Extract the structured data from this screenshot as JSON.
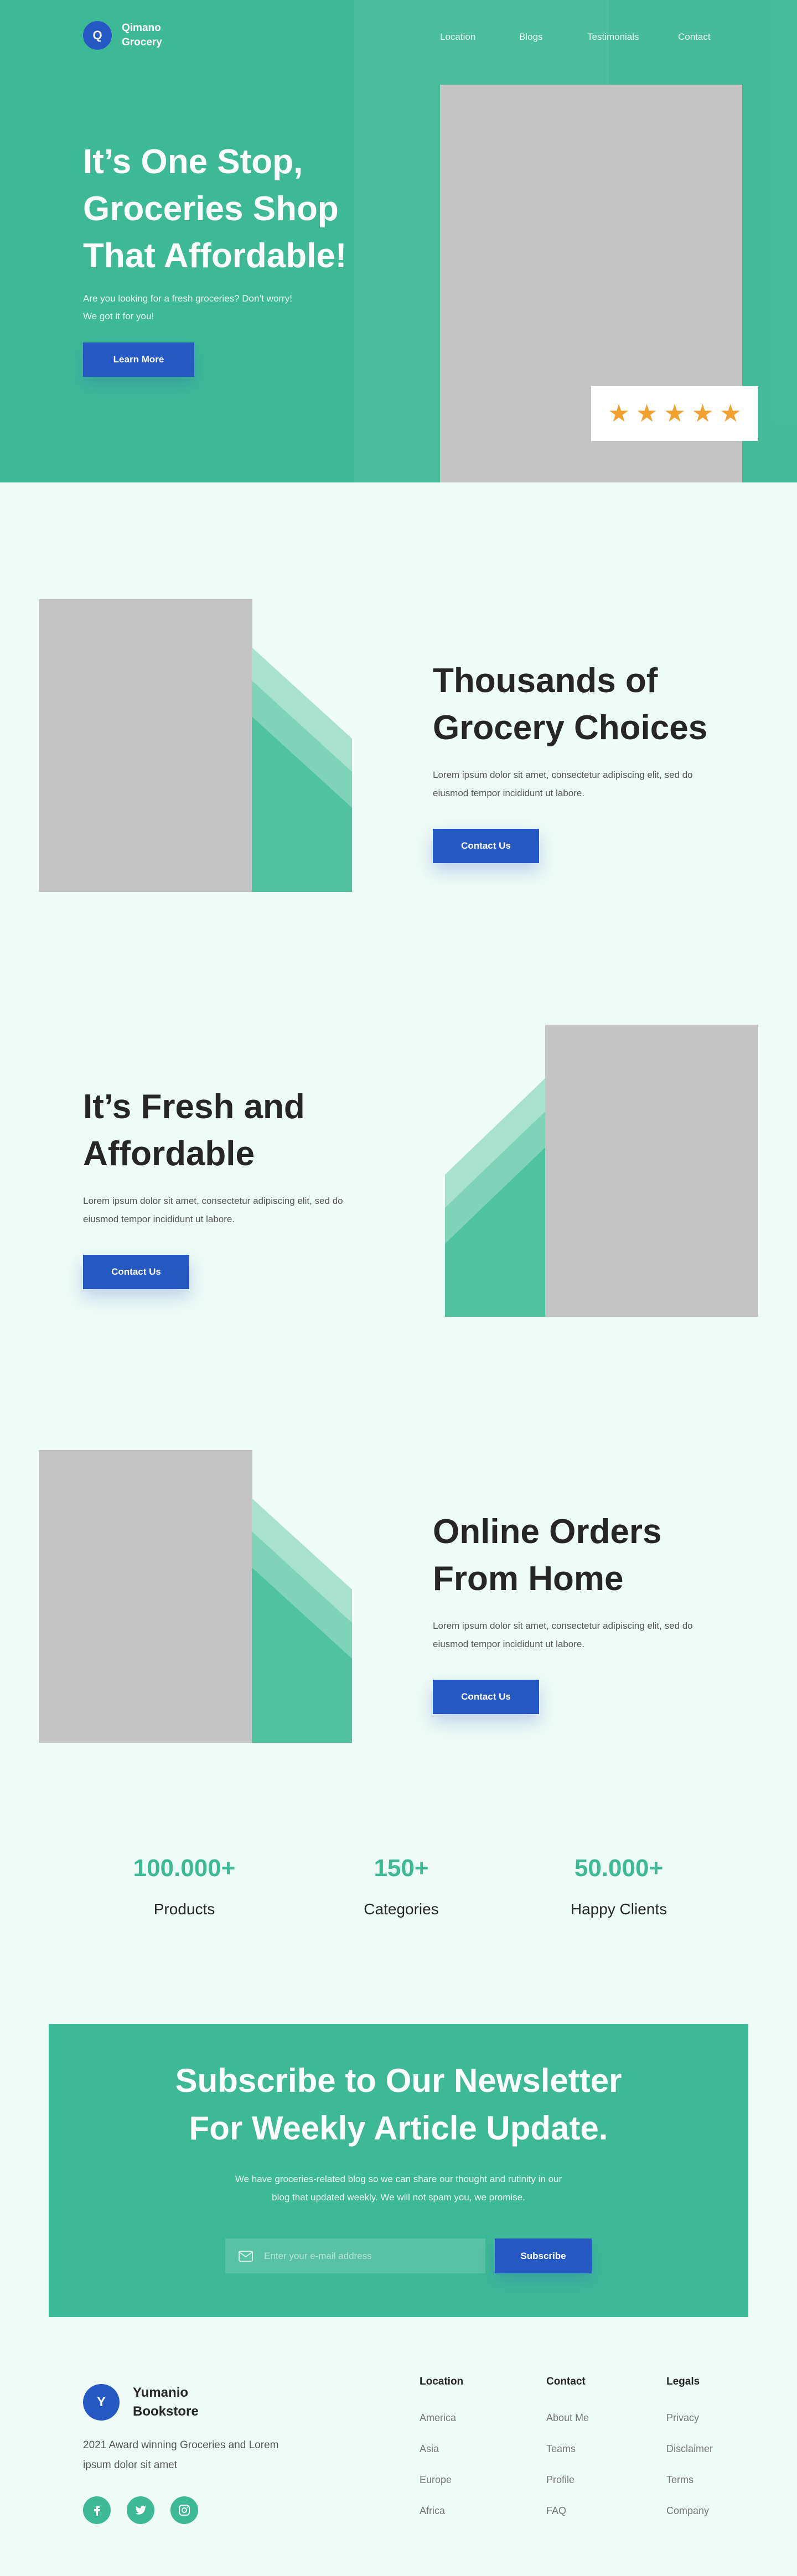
{
  "brand": {
    "initial": "Q",
    "name": "Qimano Grocery"
  },
  "nav": [
    "Location",
    "Blogs",
    "Testimonials",
    "Contact"
  ],
  "hero": {
    "title": "It’s One Stop, Groceries Shop That Affordable!",
    "subtitle_line1": "Are you looking for a fresh groceries? Don’t worry!",
    "subtitle_line2": "We got it for you!",
    "cta": "Learn More",
    "rating": {
      "stars": 5,
      "max": 5
    }
  },
  "features": [
    {
      "title": "Thousands of Grocery Choices",
      "text": "Lorem ipsum dolor sit amet, consectetur adipiscing elit, sed do eiusmod tempor incididunt ut labore.",
      "cta": "Contact Us"
    },
    {
      "title": "It’s Fresh and Affordable",
      "text": "Lorem ipsum dolor sit amet, consectetur adipiscing elit, sed do eiusmod tempor incididunt ut labore.",
      "cta": "Contact Us"
    },
    {
      "title": "Online Orders From Home",
      "text": "Lorem ipsum dolor sit amet, consectetur adipiscing elit, sed do eiusmod tempor incididunt ut labore.",
      "cta": "Contact Us"
    }
  ],
  "stats": [
    {
      "value": "100.000+",
      "label": "Products"
    },
    {
      "value": "150+",
      "label": "Categories"
    },
    {
      "value": "50.000+",
      "label": "Happy Clients"
    }
  ],
  "newsletter": {
    "title_line1": "Subscribe to Our Newsletter",
    "title_line2": "For Weekly Article Update.",
    "text_line1": "We have groceries-related blog so we can share our thought and rutinity in our",
    "text_line2": "blog that updated weekly. We will not spam you, we promise.",
    "placeholder": "Enter your e-mail address",
    "button": "Subscribe"
  },
  "footer": {
    "initial": "Y",
    "name": "Yumanio Bookstore",
    "description": "2021 Award winning Groceries and Lorem ipsum dolor sit amet",
    "social": [
      "facebook-icon",
      "twitter-icon",
      "instagram-icon"
    ],
    "columns": [
      {
        "heading": "Location",
        "links": [
          "America",
          "Asia",
          "Europe",
          "Africa"
        ]
      },
      {
        "heading": "Contact",
        "links": [
          "About Me",
          "Teams",
          "Profile",
          "FAQ"
        ]
      },
      {
        "heading": "Legals",
        "links": [
          "Privacy",
          "Disclaimer",
          "Terms",
          "Company"
        ]
      }
    ]
  },
  "colors": {
    "primary_green": "#3eb996",
    "primary_blue": "#2658c3",
    "star": "#f1a12f",
    "background": "#eefbf6"
  }
}
